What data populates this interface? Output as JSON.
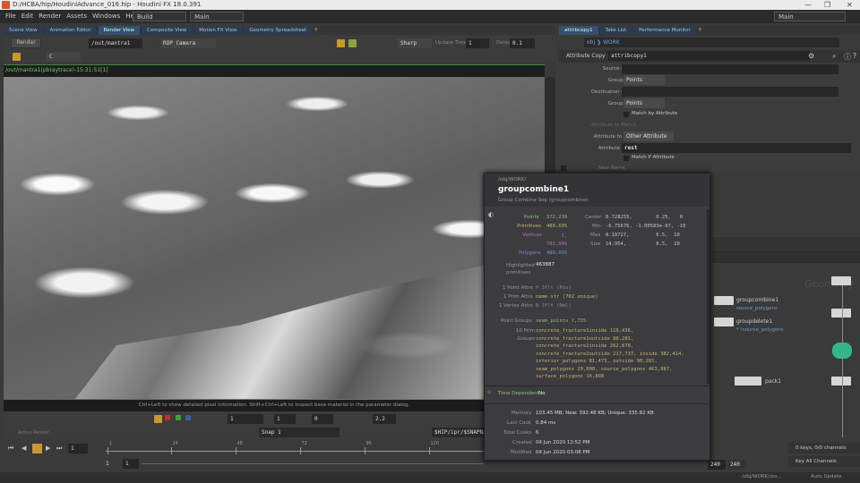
{
  "window": {
    "title": "D:/HCBA/hip/HoudiniAdvance_016.hip - Houdini FX 18.0.391",
    "min": "—",
    "max": "❐",
    "close": "✕"
  },
  "menu": [
    "File",
    "Edit",
    "Render",
    "Assets",
    "Windows",
    "Help"
  ],
  "desktop": "Build",
  "main_desk": "Main",
  "right_desk": "Main",
  "left_tabs": [
    "Scene View",
    "Animation Editor",
    "Render View",
    "Composite View",
    "Motion FX View",
    "Geometry Spreadsheet"
  ],
  "render_toolbar": {
    "render_label": "Render",
    "rop": "/out/mantra1",
    "camera": "ROP Camera",
    "sharp": "Sharp",
    "update_time_label": "Update Time",
    "update_time": "1",
    "delay_label": "Delay",
    "delay": "0.1",
    "channel": "C"
  },
  "render_path": "/out/mantra1(pbraytrace)-15:31:51[1]",
  "hint": "Ctrl+Left to show detailed pixel information. Shift+Ctrl+Left to inspect base material in the parameter dialog.",
  "render_bottom": {
    "exposure": "1",
    "gamma_val": "1",
    "zoom": "0",
    "gamma": "2.2",
    "snap": "Snap 1",
    "output": "$HIP/ipr/$SNAPNA",
    "active_render": "Active Render"
  },
  "right_tabs": [
    "attribcopy1",
    "Take List",
    "Performance Monitor"
  ],
  "right_path": {
    "obj": "obj",
    "node": "WORK"
  },
  "param_header": {
    "type": "Attribute Copy",
    "name": "attribcopy1"
  },
  "params": {
    "source_group": "Source Group",
    "group_type": "Group Type",
    "group_type_val": "Points",
    "dest_group": "Destination Group",
    "group_type2": "Group Type",
    "group_type2_val": "Points",
    "match_by_attr": "Match by Attribute",
    "attr_to_match": "Attribute to Match",
    "attr_to_copy": "Attribute to Copy",
    "attr_to_copy_val": "Other Attribute",
    "attr_name": "Attribute Name",
    "attr_name_val": "rest",
    "match_p": "Match P Attribute",
    "new_name": "New Name"
  },
  "popup": {
    "path": "/obj/WORK/",
    "name": "groupcombine1",
    "subtitle": "Group Combine Sop (groupcombine)",
    "points_l": "Points",
    "points": "372,230",
    "prims_l": "Primitives",
    "prims": "480,695",
    "verts_l": "Vertices",
    "verts": "1,\n783,046",
    "polys_l": "Polygons",
    "polys": "480,695",
    "center_l": "Center",
    "center": "0.728255,        0.25,   0",
    "min_l": "Min",
    "min": "-6.75676, -1.00583e-07, -10",
    "max_l": "Max",
    "max": "8.19727,         0.5,  10",
    "size_l": "Size",
    "size": "14.954,          0.5,  20",
    "highlighted_l": "Highlighted primitives",
    "highlighted": "463887",
    "point_attrs_l": "1 Point Attrs",
    "point_attrs": "P 3flt (Pos)",
    "prim_attrs_l": "1 Prim Attrs",
    "prim_attrs": "name str (702 unique)",
    "vertex_attrs_l": "1 Vertex Attrs",
    "vertex_attrs": "N 3flt (Nml)",
    "point_groups_l": "Point Groups",
    "point_groups": "seam_points 7,735",
    "prim_groups_l": "10 Prim Groups",
    "prim_groups": [
      "concrete_fracture1inside 119,436,",
      "concrete_fracture1outside 98,281,",
      "concrete_fracture2inside 262,878,",
      "concrete_fracture2outside 217,737, inside 382,414,",
      "interior_polygons 81,473, outside 98,281,",
      "seam_polygons 20,000, source_polygons 463,887,",
      "surface_polygons 16,808"
    ],
    "time_dep_l": "Time Dependent",
    "time_dep": "No",
    "memory_l": "Memory",
    "memory": "103.45 MB; New: 392.48 KB; Unique: 335.82 KB",
    "last_cook_l": "Last Cook",
    "last_cook": "0.84 ms",
    "total_cooks_l": "Total Cooks",
    "total_cooks": "6",
    "created_l": "Created",
    "created": "04 Jun 2020 12:52 PM",
    "modified_l": "Modified",
    "modified": "04 Jun 2020 03:08 PM"
  },
  "network": {
    "watermark": "Geometry",
    "nodes": [
      {
        "name": "groupcombine1",
        "comment": "source_polygons"
      },
      {
        "name": "groupdelete1",
        "comment": "* !source_polygons"
      },
      {
        "name": "pack1",
        "comment": ""
      }
    ]
  },
  "timeline": {
    "frame": "1",
    "start": "1",
    "start2": "1",
    "end": "240",
    "end2": "240",
    "ticks": [
      "1",
      "24",
      "48",
      "72",
      "96",
      "120",
      "144",
      "168",
      "192",
      "216"
    ]
  },
  "keys": {
    "status": "0 keys, 0/0 channels",
    "key_all": "Key All Channels"
  },
  "status": {
    "path": "/obj/WORK/sto...",
    "auto_update": "Auto Update"
  }
}
